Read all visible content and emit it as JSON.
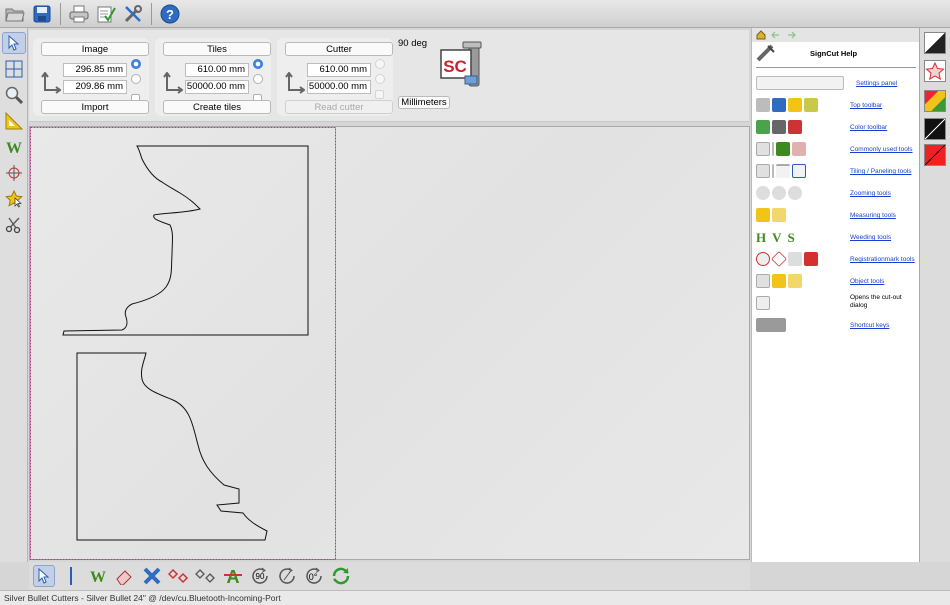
{
  "top_toolbar": {
    "buttons": [
      "open-icon",
      "save-icon",
      "print-icon",
      "checklist-icon",
      "tools-icon",
      "help-icon"
    ]
  },
  "left_toolbar": {
    "buttons": [
      "pointer-icon",
      "tile-grid-icon",
      "zoom-icon",
      "measure-icon",
      "weed-icon",
      "registration-icon",
      "star-object-icon",
      "scissors-icon"
    ]
  },
  "settings": {
    "image": {
      "label": "Image",
      "width": "296.85 mm",
      "height": "209.86 mm",
      "action": "Import"
    },
    "tiles": {
      "label": "Tiles",
      "width": "610.00 mm",
      "height": "50000.00 mm",
      "action": "Create tiles"
    },
    "cutter": {
      "label": "Cutter",
      "width": "610.00 mm",
      "height": "50000.00 mm",
      "action": "Read cutter"
    },
    "orientation": "90 deg",
    "units": "Millimeters",
    "logo_text": "SC"
  },
  "help": {
    "title": "SignCut Help",
    "items": [
      {
        "label": "Settings panel",
        "type": "link"
      },
      {
        "label": "Top toolbar",
        "type": "link"
      },
      {
        "label": "Color toolbar",
        "type": "link"
      },
      {
        "label": "Commonly used tools",
        "type": "link"
      },
      {
        "label": "Tiling / Paneling tools",
        "type": "link"
      },
      {
        "label": "Zooming tools",
        "type": "link"
      },
      {
        "label": "Measuring tools",
        "type": "link"
      },
      {
        "label": "Weeding tools",
        "type": "link"
      },
      {
        "label": "Registrationmark tools",
        "type": "link"
      },
      {
        "label": "Object tools",
        "type": "link"
      },
      {
        "label": "Opens the cut-out dialog",
        "type": "text"
      },
      {
        "label": "Shortcut keys",
        "type": "link"
      }
    ],
    "weed_letters": [
      "H",
      "V",
      "S"
    ]
  },
  "bottom_toolbar": {
    "rotate_90_label": "90",
    "rotate_0_label": "0°"
  },
  "status": {
    "text": "Silver Bullet Cutters - Silver Bullet 24\" @ /dev/cu.Bluetooth-Incoming-Port"
  },
  "colors": {
    "selection_border": "#b03a8a",
    "link": "#1a3fd0",
    "weed_green": "#3d8a1e",
    "registration_red": "#d43030"
  }
}
